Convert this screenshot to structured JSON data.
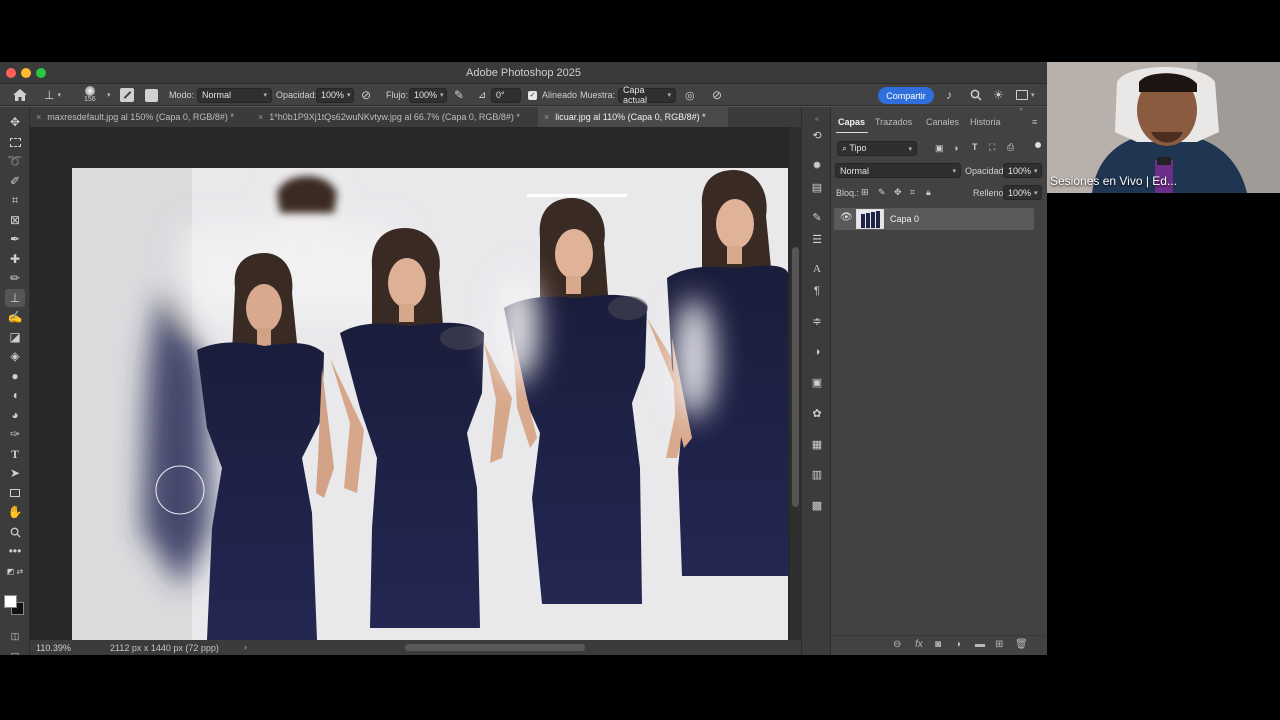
{
  "window": {
    "title": "Adobe Photoshop 2025",
    "colors": {
      "close": "#ff5f57",
      "minimize": "#febc2e",
      "zoom": "#28c840",
      "accent": "#2f6fdb"
    }
  },
  "options_bar": {
    "brush_size": "156",
    "mode_label": "Modo:",
    "mode_value": "Normal",
    "opacity_label": "Opacidad:",
    "opacity_value": "100%",
    "flow_label": "Flujo:",
    "flow_value": "100%",
    "angle_value": "0°",
    "aligned_label": "Alineado",
    "aligned_checked": true,
    "sample_label": "Muestra:",
    "sample_value": "Capa actual",
    "share_label": "Compartir"
  },
  "tabs": [
    {
      "label": "maxresdefault.jpg al 150% (Capa 0, RGB/8#) *",
      "active": false
    },
    {
      "label": "1*h0b1P9Xj1tQs62wuNKvtyw.jpg al 66.7% (Capa 0, RGB/8#) *",
      "active": false
    },
    {
      "label": "licuar.jpg al 110% (Capa 0, RGB/8#) *",
      "active": true
    }
  ],
  "status": {
    "zoom": "110.39%",
    "doc_info": "2112 px x 1440 px (72 ppp)"
  },
  "layers_panel": {
    "tabs": [
      "Capas",
      "Trazados",
      "Canales",
      "Historia"
    ],
    "filter_value": "Tipo",
    "blend_mode": "Normal",
    "opacity_label": "Opacidad:",
    "opacity_value": "100%",
    "lock_label": "Bloq.:",
    "fill_label": "Relleno:",
    "fill_value": "100%",
    "layers": [
      {
        "name": "Capa 0",
        "visible": true
      }
    ]
  },
  "webcam": {
    "caption": "Sesiones en Vivo | Ed..."
  },
  "icons": {
    "toolbar": [
      "move-icon",
      "marquee-icon",
      "lasso-icon",
      "quick-select-icon",
      "crop-icon",
      "frame-icon",
      "eyedropper-icon",
      "healing-icon",
      "brush-icon",
      "clone-stamp-icon",
      "history-brush-icon",
      "eraser-icon",
      "paint-bucket-icon",
      "blur-icon",
      "dodge-icon",
      "pen-icon",
      "type-icon",
      "path-select-icon",
      "rectangle-icon",
      "hand-icon",
      "zoom-icon",
      "more-tools-icon"
    ],
    "strip": [
      "history-icon",
      "brightness-icon",
      "actions-icon",
      "brush-settings-icon",
      "properties-icon",
      "character-icon",
      "paragraph-icon",
      "adjustments-icon",
      "color-icon",
      "libraries-icon",
      "glyphs-icon",
      "swatches-icon",
      "gradients-icon",
      "patterns-icon"
    ]
  }
}
